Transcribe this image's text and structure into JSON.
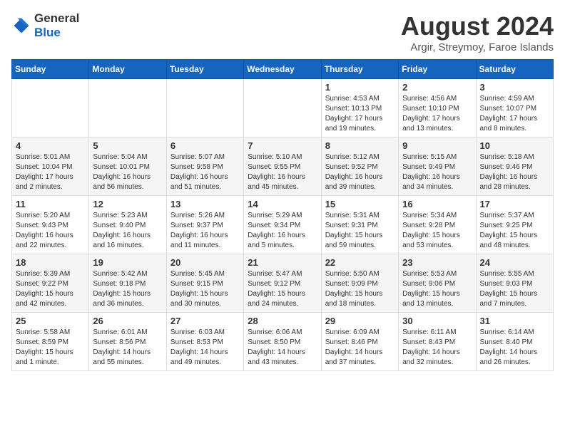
{
  "header": {
    "logo_general": "General",
    "logo_blue": "Blue",
    "month_year": "August 2024",
    "location": "Argir, Streymoy, Faroe Islands"
  },
  "days_of_week": [
    "Sunday",
    "Monday",
    "Tuesday",
    "Wednesday",
    "Thursday",
    "Friday",
    "Saturday"
  ],
  "weeks": [
    [
      {
        "day": "",
        "info": ""
      },
      {
        "day": "",
        "info": ""
      },
      {
        "day": "",
        "info": ""
      },
      {
        "day": "",
        "info": ""
      },
      {
        "day": "1",
        "info": "Sunrise: 4:53 AM\nSunset: 10:13 PM\nDaylight: 17 hours\nand 19 minutes."
      },
      {
        "day": "2",
        "info": "Sunrise: 4:56 AM\nSunset: 10:10 PM\nDaylight: 17 hours\nand 13 minutes."
      },
      {
        "day": "3",
        "info": "Sunrise: 4:59 AM\nSunset: 10:07 PM\nDaylight: 17 hours\nand 8 minutes."
      }
    ],
    [
      {
        "day": "4",
        "info": "Sunrise: 5:01 AM\nSunset: 10:04 PM\nDaylight: 17 hours\nand 2 minutes."
      },
      {
        "day": "5",
        "info": "Sunrise: 5:04 AM\nSunset: 10:01 PM\nDaylight: 16 hours\nand 56 minutes."
      },
      {
        "day": "6",
        "info": "Sunrise: 5:07 AM\nSunset: 9:58 PM\nDaylight: 16 hours\nand 51 minutes."
      },
      {
        "day": "7",
        "info": "Sunrise: 5:10 AM\nSunset: 9:55 PM\nDaylight: 16 hours\nand 45 minutes."
      },
      {
        "day": "8",
        "info": "Sunrise: 5:12 AM\nSunset: 9:52 PM\nDaylight: 16 hours\nand 39 minutes."
      },
      {
        "day": "9",
        "info": "Sunrise: 5:15 AM\nSunset: 9:49 PM\nDaylight: 16 hours\nand 34 minutes."
      },
      {
        "day": "10",
        "info": "Sunrise: 5:18 AM\nSunset: 9:46 PM\nDaylight: 16 hours\nand 28 minutes."
      }
    ],
    [
      {
        "day": "11",
        "info": "Sunrise: 5:20 AM\nSunset: 9:43 PM\nDaylight: 16 hours\nand 22 minutes."
      },
      {
        "day": "12",
        "info": "Sunrise: 5:23 AM\nSunset: 9:40 PM\nDaylight: 16 hours\nand 16 minutes."
      },
      {
        "day": "13",
        "info": "Sunrise: 5:26 AM\nSunset: 9:37 PM\nDaylight: 16 hours\nand 11 minutes."
      },
      {
        "day": "14",
        "info": "Sunrise: 5:29 AM\nSunset: 9:34 PM\nDaylight: 16 hours\nand 5 minutes."
      },
      {
        "day": "15",
        "info": "Sunrise: 5:31 AM\nSunset: 9:31 PM\nDaylight: 15 hours\nand 59 minutes."
      },
      {
        "day": "16",
        "info": "Sunrise: 5:34 AM\nSunset: 9:28 PM\nDaylight: 15 hours\nand 53 minutes."
      },
      {
        "day": "17",
        "info": "Sunrise: 5:37 AM\nSunset: 9:25 PM\nDaylight: 15 hours\nand 48 minutes."
      }
    ],
    [
      {
        "day": "18",
        "info": "Sunrise: 5:39 AM\nSunset: 9:22 PM\nDaylight: 15 hours\nand 42 minutes."
      },
      {
        "day": "19",
        "info": "Sunrise: 5:42 AM\nSunset: 9:18 PM\nDaylight: 15 hours\nand 36 minutes."
      },
      {
        "day": "20",
        "info": "Sunrise: 5:45 AM\nSunset: 9:15 PM\nDaylight: 15 hours\nand 30 minutes."
      },
      {
        "day": "21",
        "info": "Sunrise: 5:47 AM\nSunset: 9:12 PM\nDaylight: 15 hours\nand 24 minutes."
      },
      {
        "day": "22",
        "info": "Sunrise: 5:50 AM\nSunset: 9:09 PM\nDaylight: 15 hours\nand 18 minutes."
      },
      {
        "day": "23",
        "info": "Sunrise: 5:53 AM\nSunset: 9:06 PM\nDaylight: 15 hours\nand 13 minutes."
      },
      {
        "day": "24",
        "info": "Sunrise: 5:55 AM\nSunset: 9:03 PM\nDaylight: 15 hours\nand 7 minutes."
      }
    ],
    [
      {
        "day": "25",
        "info": "Sunrise: 5:58 AM\nSunset: 8:59 PM\nDaylight: 15 hours\nand 1 minute."
      },
      {
        "day": "26",
        "info": "Sunrise: 6:01 AM\nSunset: 8:56 PM\nDaylight: 14 hours\nand 55 minutes."
      },
      {
        "day": "27",
        "info": "Sunrise: 6:03 AM\nSunset: 8:53 PM\nDaylight: 14 hours\nand 49 minutes."
      },
      {
        "day": "28",
        "info": "Sunrise: 6:06 AM\nSunset: 8:50 PM\nDaylight: 14 hours\nand 43 minutes."
      },
      {
        "day": "29",
        "info": "Sunrise: 6:09 AM\nSunset: 8:46 PM\nDaylight: 14 hours\nand 37 minutes."
      },
      {
        "day": "30",
        "info": "Sunrise: 6:11 AM\nSunset: 8:43 PM\nDaylight: 14 hours\nand 32 minutes."
      },
      {
        "day": "31",
        "info": "Sunrise: 6:14 AM\nSunset: 8:40 PM\nDaylight: 14 hours\nand 26 minutes."
      }
    ]
  ]
}
